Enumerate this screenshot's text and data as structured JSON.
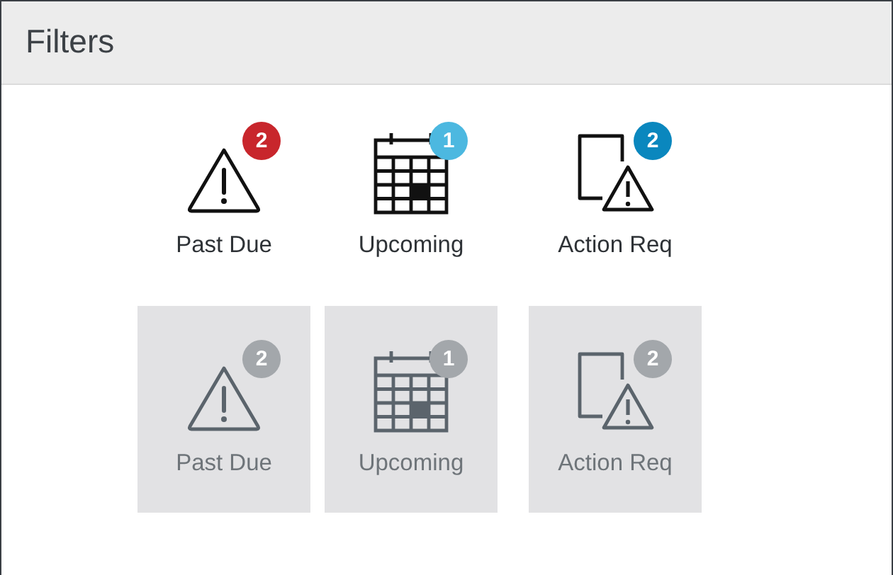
{
  "header": {
    "title": "Filters"
  },
  "rows": [
    {
      "items": [
        {
          "kind": "warning",
          "label": "Past Due",
          "count": "2",
          "color": "#c8262c",
          "disabled": false
        },
        {
          "kind": "calendar",
          "label": "Upcoming",
          "count": "1",
          "color": "#4cb8e0",
          "disabled": false
        },
        {
          "kind": "document-warning",
          "label": "Action Req",
          "count": "2",
          "color": "#0a87be",
          "disabled": false
        }
      ]
    },
    {
      "items": [
        {
          "kind": "warning",
          "label": "Past Due",
          "count": "2",
          "color": "#a3a7ab",
          "disabled": true
        },
        {
          "kind": "calendar",
          "label": "Upcoming",
          "count": "1",
          "color": "#a3a7ab",
          "disabled": true
        },
        {
          "kind": "document-warning",
          "label": "Action Req",
          "count": "2",
          "color": "#a3a7ab",
          "disabled": true
        }
      ]
    }
  ]
}
